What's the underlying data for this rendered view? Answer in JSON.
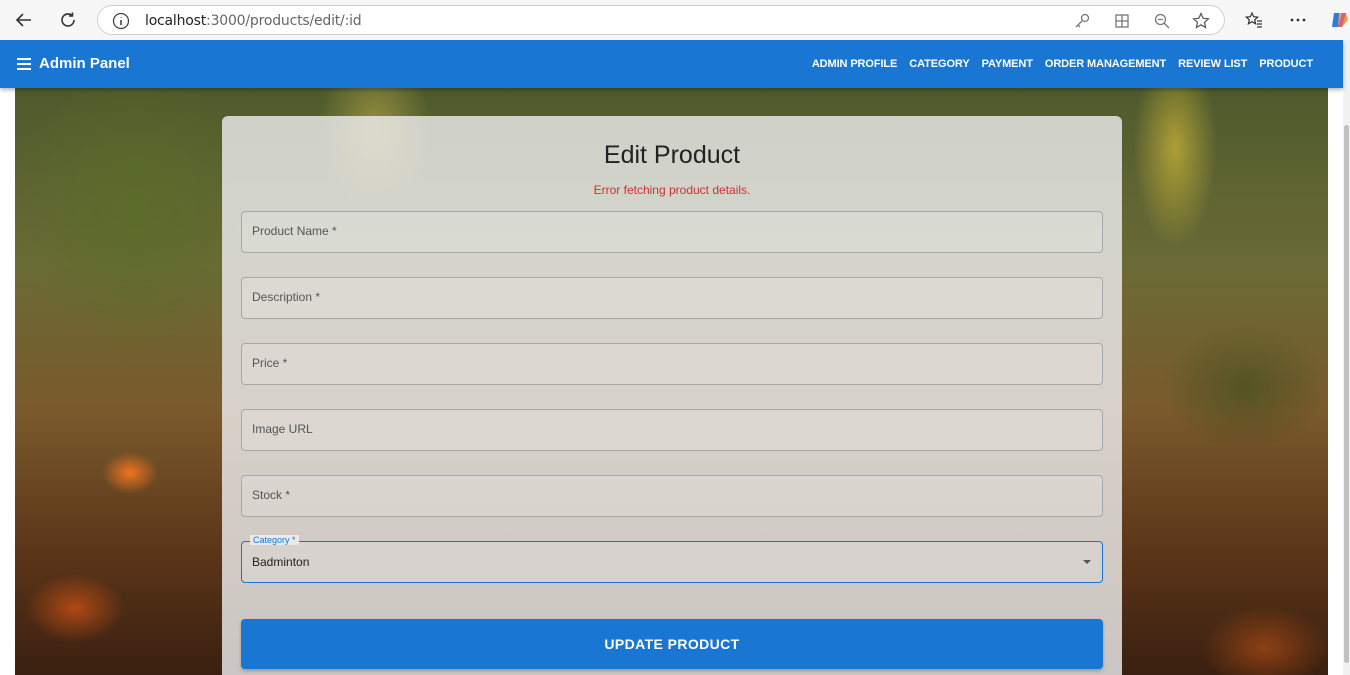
{
  "browser": {
    "url_host": "localhost",
    "url_path": ":3000/products/edit/:id"
  },
  "appbar": {
    "brand": "Admin Panel",
    "nav": [
      "ADMIN PROFILE",
      "CATEGORY",
      "PAYMENT",
      "ORDER MANAGEMENT",
      "REVIEW LIST",
      "PRODUCT"
    ]
  },
  "form": {
    "title": "Edit Product",
    "error": "Error fetching product details.",
    "fields": [
      {
        "label": "Product Name *"
      },
      {
        "label": "Description *"
      },
      {
        "label": "Price *"
      },
      {
        "label": "Image URL"
      },
      {
        "label": "Stock *"
      }
    ],
    "category": {
      "label": "Category *",
      "value": "Badminton"
    },
    "submit_label": "UPDATE PRODUCT"
  },
  "colors": {
    "primary": "#1976d2",
    "error": "#d32f2f"
  }
}
